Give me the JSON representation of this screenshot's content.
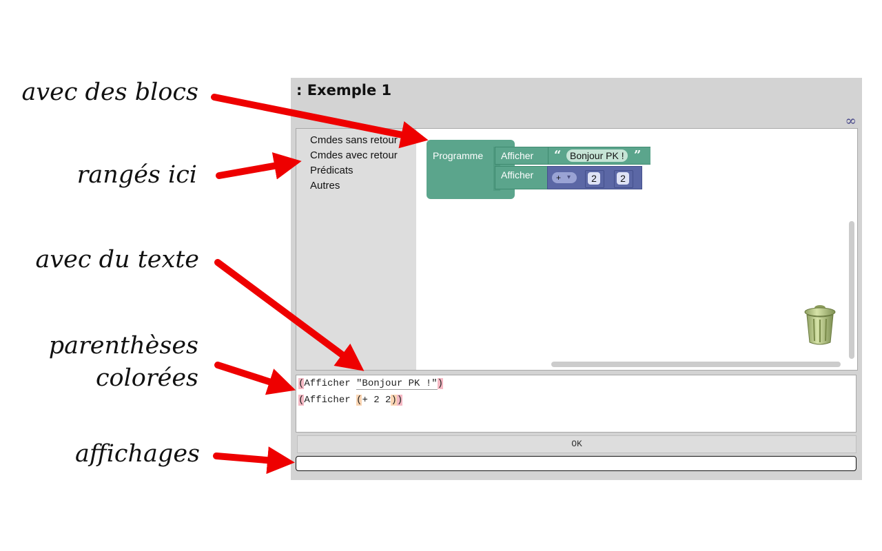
{
  "annotations": [
    {
      "id": "blocks",
      "text": "avec des blocs"
    },
    {
      "id": "ranges",
      "text": "rangés ici"
    },
    {
      "id": "text",
      "text": "avec du texte"
    },
    {
      "id": "parens1",
      "text": "parenthèses"
    },
    {
      "id": "parens2",
      "text": "colorées"
    },
    {
      "id": "display",
      "text": "affichages"
    }
  ],
  "panel": {
    "title": ": Exemple 1",
    "infinity": "∞"
  },
  "toolbox": {
    "items": [
      "Cmdes sans retour",
      "Cmdes avec retour",
      "Prédicats",
      "Autres"
    ]
  },
  "blocks": {
    "program_label": "Programme",
    "print1_label": "Afficher",
    "print2_label": "Afficher",
    "quote_open": "“",
    "quote_close": "”",
    "string_value": "Bonjour PK !",
    "op_symbol": "+",
    "op_dropdown": "▾",
    "num1": "2",
    "num2": "2"
  },
  "code": {
    "line1": {
      "open": "(",
      "cmd": "Afficher ",
      "str": "\"Bonjour PK !\"",
      "close": ")"
    },
    "line2": {
      "open": "(",
      "cmd": "Afficher ",
      "inner_open": "(",
      "inner": "+ 2 2",
      "inner_close": ")",
      "close": ")"
    }
  },
  "buttons": {
    "ok": "OK"
  },
  "output": {
    "value": ""
  },
  "colors": {
    "arrow": "#ee0000",
    "green_block": "#5ba58c",
    "purple_block": "#5b67a5",
    "paren_outer": "#f5b9c4",
    "paren_inner": "#fbd6b4"
  }
}
